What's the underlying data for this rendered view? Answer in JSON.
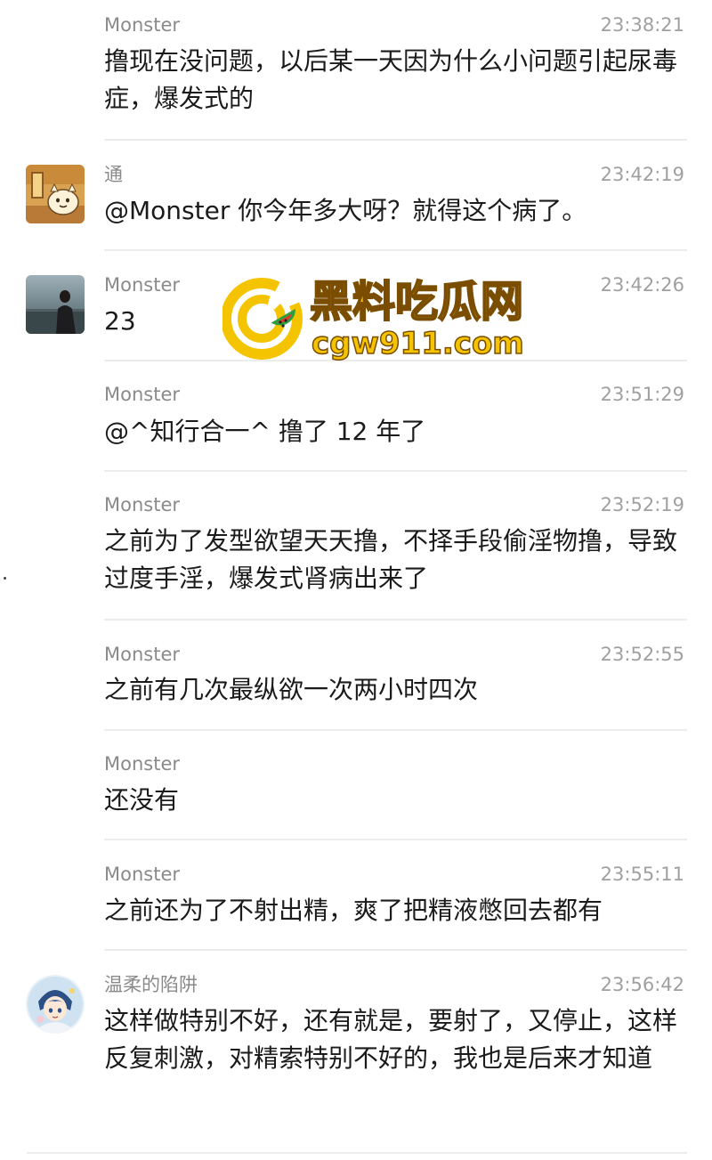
{
  "messages": [
    {
      "sender": "Monster",
      "time": "23:38:21",
      "text": "撸现在没问题，以后某一天因为什么小问题引起尿毒症，爆发式的",
      "avatar": ""
    },
    {
      "sender": "通",
      "time": "23:42:19",
      "text": "@Monster 你今年多大呀？就得这个病了。",
      "avatar": "cartoon-avatar"
    },
    {
      "sender": "Monster",
      "time": "23:42:26",
      "text": "23",
      "avatar": "person-photo-avatar"
    },
    {
      "sender": "Monster",
      "time": "23:51:29",
      "text": "@^知行合一^ 撸了 12 年了",
      "avatar": ""
    },
    {
      "sender": "Monster",
      "time": "23:52:19",
      "text": "之前为了发型欲望天天撸，不择手段偷淫物撸，导致过度手淫，爆发式肾病出来了",
      "avatar": ""
    },
    {
      "sender": "Monster",
      "time": "23:52:55",
      "text": "之前有几次最纵欲一次两小时四次",
      "avatar": ""
    },
    {
      "sender": "Monster",
      "time": "",
      "text": "还没有",
      "avatar": ""
    },
    {
      "sender": "Monster",
      "time": "23:55:11",
      "text": "之前还为了不射出精，爽了把精液憋回去都有",
      "avatar": ""
    },
    {
      "sender": "温柔的陷阱",
      "time": "23:56:42",
      "text": "这样做特别不好，还有就是，要射了，又停止，这样反复刺激，对精索特别不好的，我也是后来才知道",
      "avatar": "anime-avatar"
    }
  ],
  "watermark": {
    "title": "黑料吃瓜网",
    "url": "cgw911.com",
    "logo_icon": "cg-watermelon-logo-icon",
    "colors": {
      "yellow": "#f5c400",
      "outline": "#7a4d00",
      "red": "#e8362b",
      "green": "#2e9e3e"
    }
  }
}
